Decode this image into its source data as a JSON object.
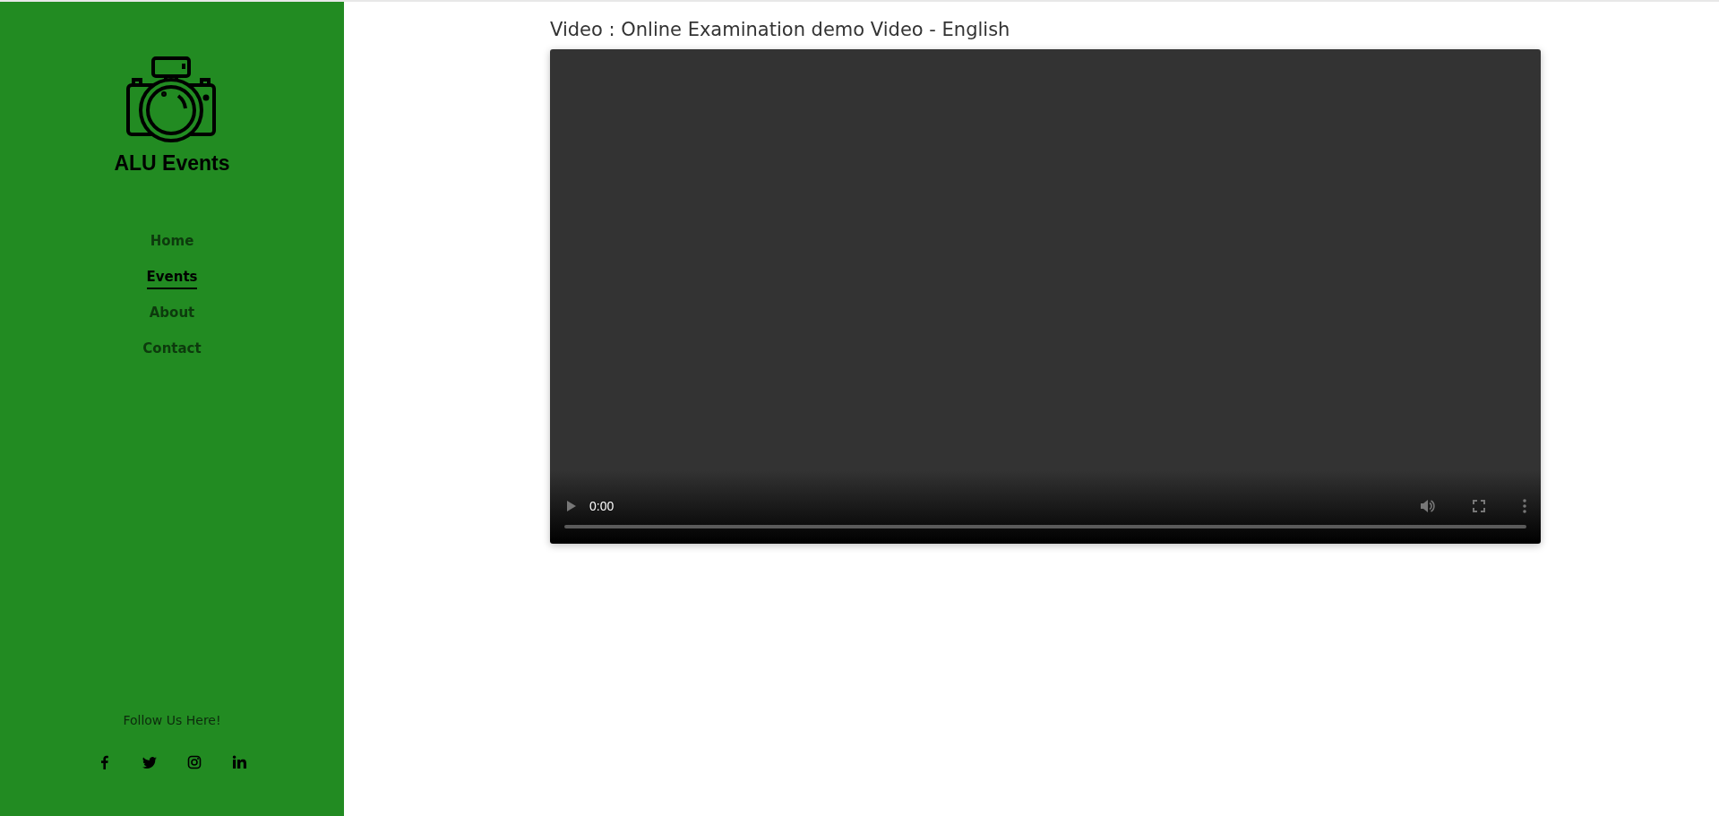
{
  "sidebar": {
    "brand": "ALU Events",
    "nav": [
      {
        "label": "Home",
        "selected": false
      },
      {
        "label": "Events",
        "selected": true
      },
      {
        "label": "About",
        "selected": false
      },
      {
        "label": "Contact",
        "selected": false
      }
    ],
    "follow_text": "Follow Us Here!"
  },
  "main": {
    "title": "Video : Online Examination demo Video - English",
    "video": {
      "time": "0:00",
      "level": 0
    }
  }
}
